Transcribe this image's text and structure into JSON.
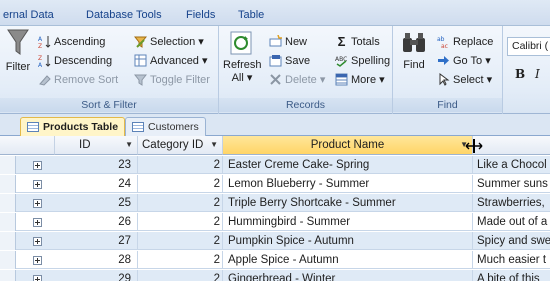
{
  "ribbon_tabs": [
    "ernal Data",
    "Database Tools",
    "Fields",
    "Table"
  ],
  "groups": {
    "sort_filter": {
      "label": "Sort & Filter",
      "filter": "Filter",
      "ascending": "Ascending",
      "descending": "Descending",
      "remove_sort": "Remove Sort",
      "selection": "Selection ▾",
      "advanced": "Advanced ▾",
      "toggle_filter": "Toggle Filter"
    },
    "records": {
      "label": "Records",
      "refresh": "Refresh",
      "refresh_all": "All ▾",
      "new": "New",
      "save": "Save",
      "delete": "Delete ▾",
      "totals": "Totals",
      "spelling": "Spelling",
      "more": "More ▾"
    },
    "find": {
      "label": "Find",
      "find": "Find",
      "replace": "Replace",
      "goto": "Go To ▾",
      "select": "Select ▾"
    },
    "text_formatting": {
      "font": "Calibri (",
      "bold": "B",
      "italic": "I"
    }
  },
  "doc_tabs": [
    "Products Table",
    "Customers"
  ],
  "columns": [
    "ID",
    "Category ID",
    "Product Name",
    ""
  ],
  "rows": [
    {
      "id": "23",
      "category": "2",
      "name": "Easter Creme Cake- Spring",
      "desc": "Like a Chocol"
    },
    {
      "id": "24",
      "category": "2",
      "name": "Lemon Blueberry - Summer",
      "desc": "Summer suns"
    },
    {
      "id": "25",
      "category": "2",
      "name": "Triple Berry Shortcake - Summer",
      "desc": "Strawberries,"
    },
    {
      "id": "26",
      "category": "2",
      "name": "Hummingbird - Summer",
      "desc": "Made out of a"
    },
    {
      "id": "27",
      "category": "2",
      "name": "Pumpkin Spice - Autumn",
      "desc": "Spicy and swe"
    },
    {
      "id": "28",
      "category": "2",
      "name": "Apple Spice - Autumn",
      "desc": "Much easier t"
    },
    {
      "id": "29",
      "category": "2",
      "name": "Gingerbread - Winter",
      "desc": "A bite of this"
    }
  ]
}
